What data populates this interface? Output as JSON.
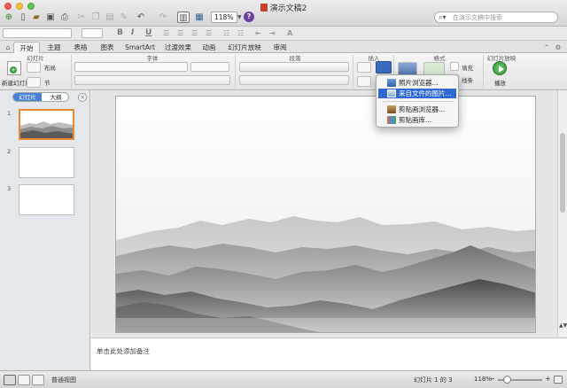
{
  "window": {
    "title": "演示文稿2",
    "zoom": "118%"
  },
  "search": {
    "placeholder": "在演示文稿中搜索"
  },
  "ribbon": {
    "tabs": [
      {
        "label": "开始",
        "active": true
      },
      {
        "label": "主题"
      },
      {
        "label": "表格"
      },
      {
        "label": "图表"
      },
      {
        "label": "SmartArt"
      },
      {
        "label": "过渡效果"
      },
      {
        "label": "动画"
      },
      {
        "label": "幻灯片放映"
      },
      {
        "label": "审阅"
      }
    ],
    "groups": {
      "slides": "幻灯片",
      "font": "字体",
      "paragraph": "段落",
      "insert": "插入",
      "format": "格式",
      "slideshow": "幻灯片放映"
    },
    "new_slide_label": "新建幻灯片",
    "layout_label": "布局",
    "section_label": "节",
    "fill_label": "填充",
    "line_label": "线条",
    "play_label": "播放",
    "format_bold": "B",
    "format_italic": "I",
    "format_underline": "U"
  },
  "picture_menu": {
    "items": [
      {
        "label": "照片浏览器...",
        "icon": "photo-browser-icon"
      },
      {
        "label": "来自文件的图片...",
        "icon": "picture-from-file-icon",
        "highlighted": true
      },
      {
        "label": "剪贴画浏览器...",
        "icon": "clipart-browser-icon"
      },
      {
        "label": "剪贴画库...",
        "icon": "clipart-gallery-icon"
      }
    ]
  },
  "slide_pane": {
    "tab_slides": "幻灯片",
    "tab_outline": "大纲",
    "slides": [
      {
        "number": "1",
        "selected": true
      },
      {
        "number": "2"
      },
      {
        "number": "3"
      }
    ]
  },
  "notes": {
    "placeholder": "单击此处添加备注"
  },
  "status_bar": {
    "view_name": "普通视图",
    "slide_position": "幻灯片 1 的 3",
    "zoom": "118%"
  },
  "colors": {
    "accent_highlight": "#2e68d4",
    "selected_thumb_border": "#e8882f",
    "play_button": "#3aa04a"
  }
}
